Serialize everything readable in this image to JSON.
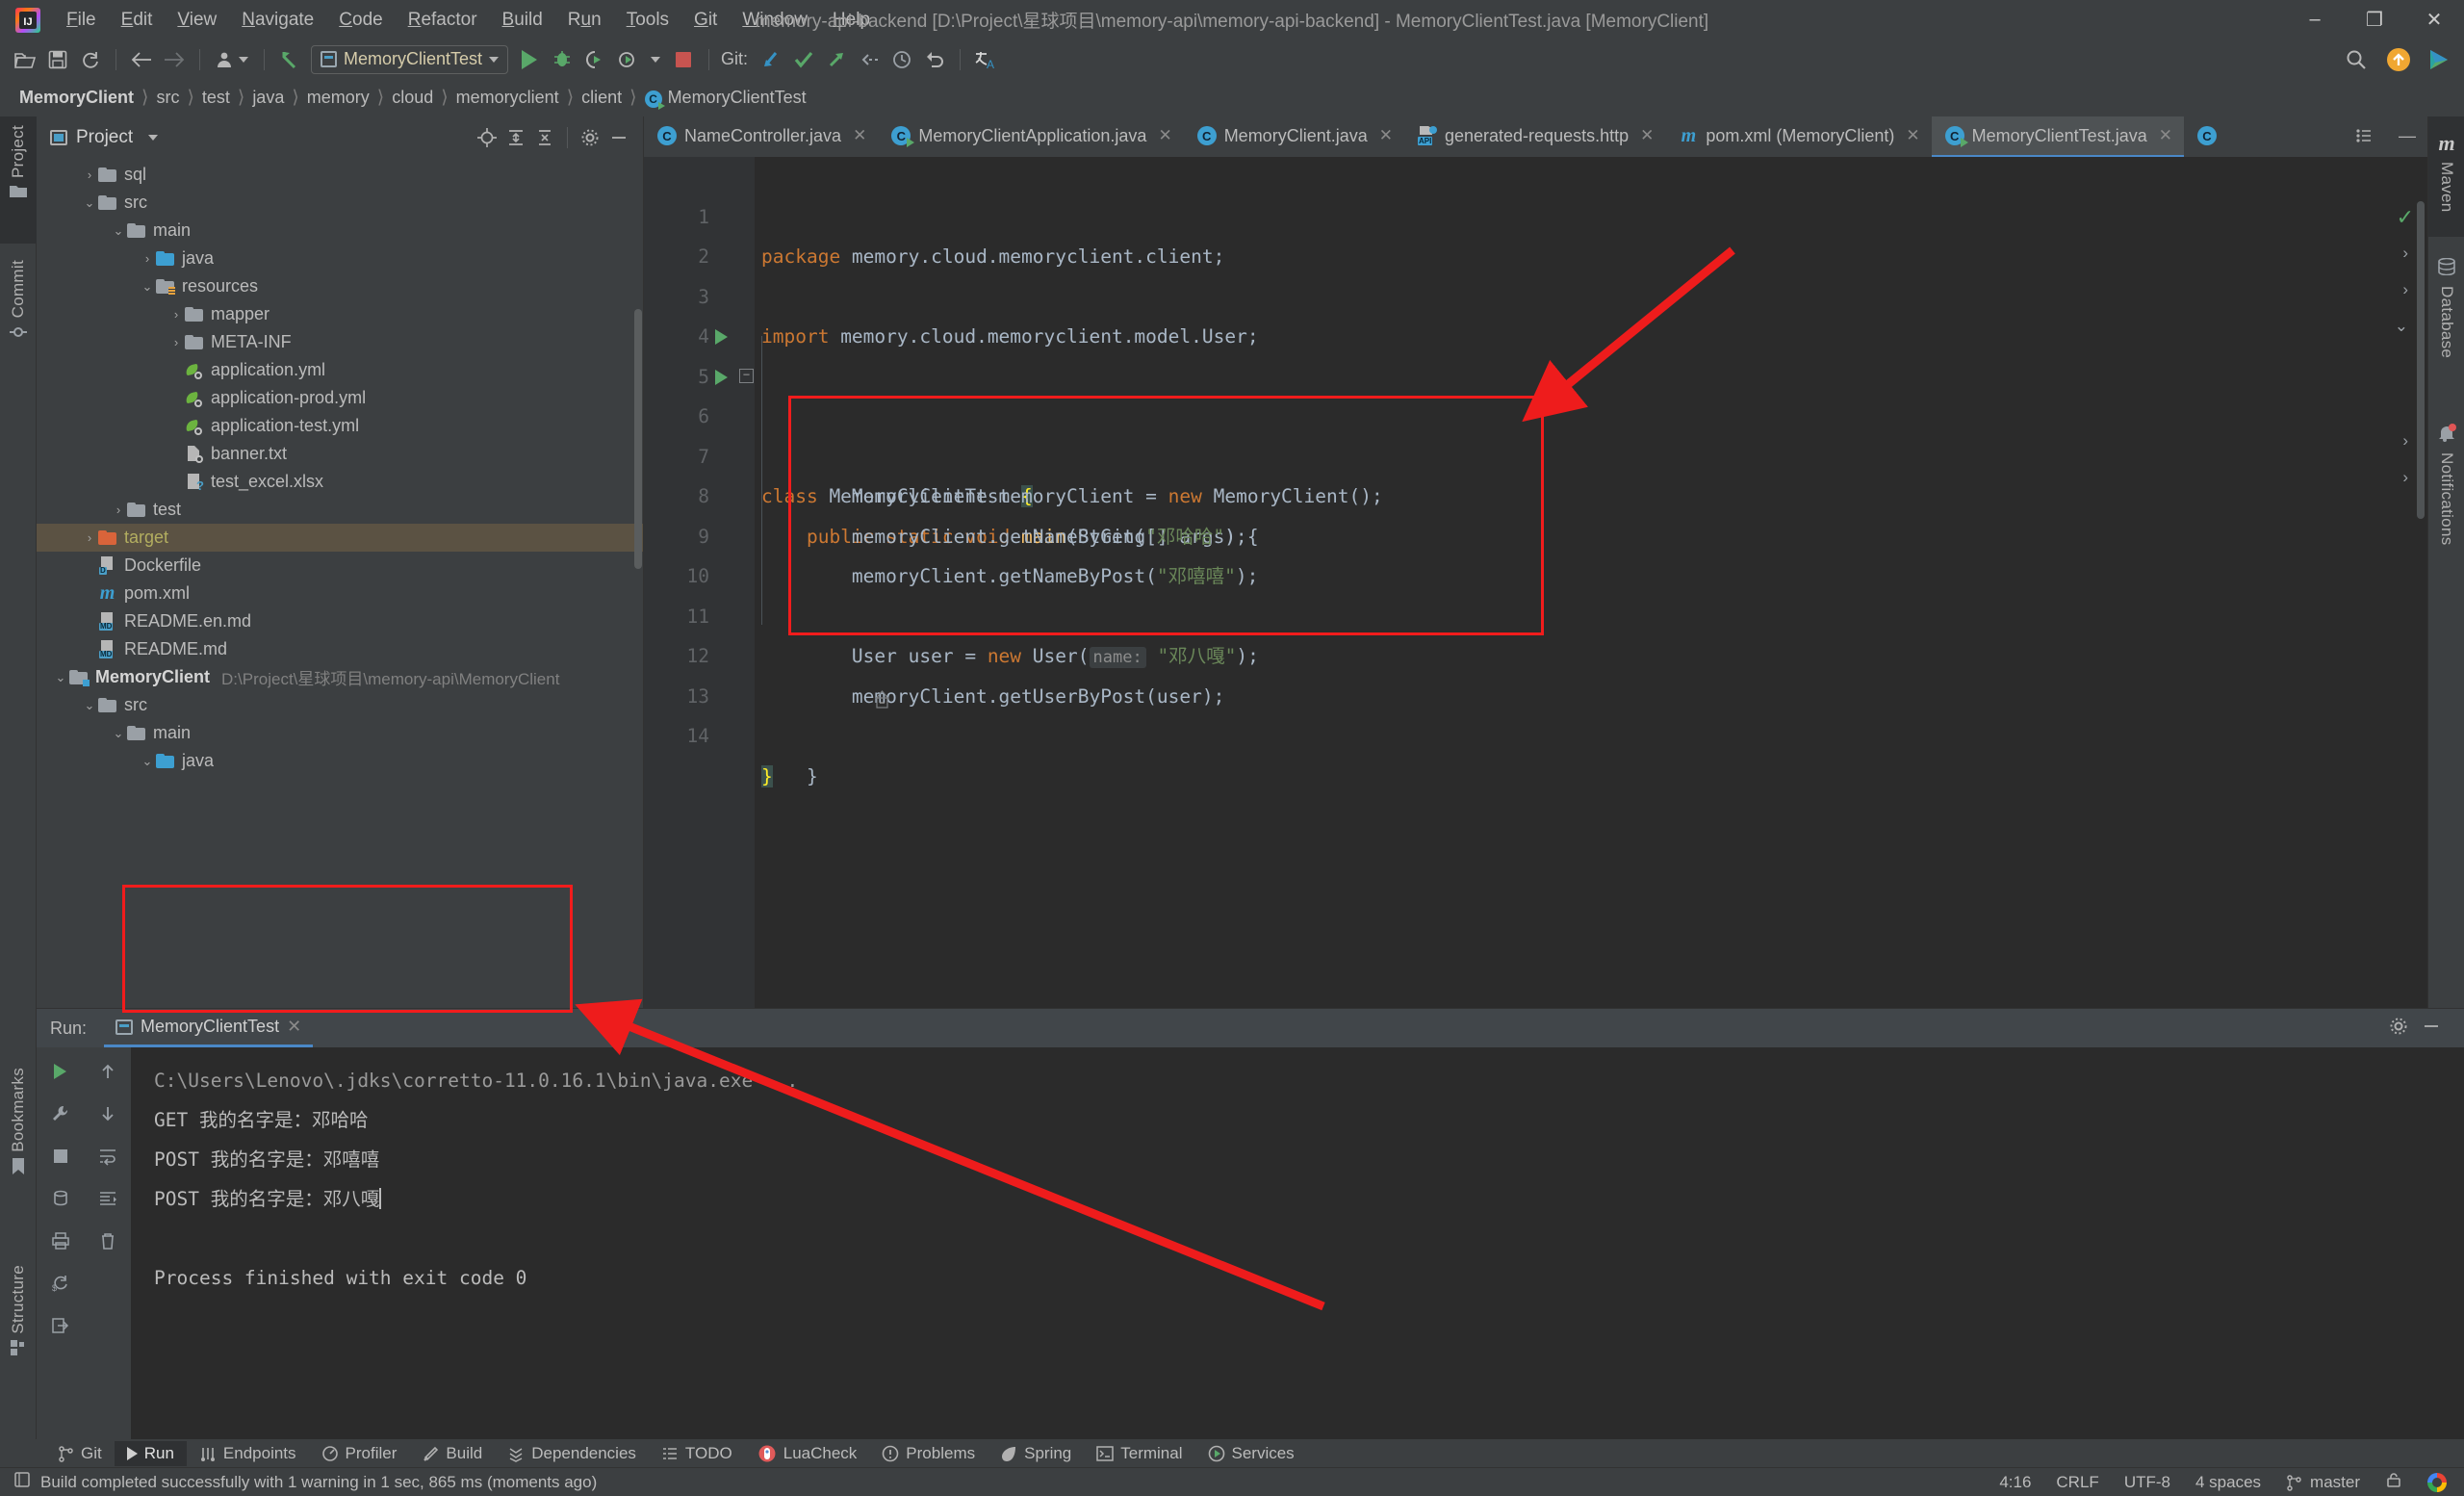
{
  "window": {
    "title": "memory-api-backend [D:\\Project\\星球项目\\memory-api\\memory-api-backend] - MemoryClientTest.java [MemoryClient]",
    "minimize": "—",
    "maximize": "❐",
    "close": "✕",
    "logo_text": "IJ"
  },
  "menubar": {
    "items": [
      {
        "label": "File"
      },
      {
        "label": "Edit"
      },
      {
        "label": "View"
      },
      {
        "label": "Navigate"
      },
      {
        "label": "Code"
      },
      {
        "label": "Refactor"
      },
      {
        "label": "Build"
      },
      {
        "label": "Run"
      },
      {
        "label": "Tools"
      },
      {
        "label": "Git"
      },
      {
        "label": "Window"
      },
      {
        "label": "Help"
      }
    ]
  },
  "toolbar": {
    "run_config": "MemoryClientTest",
    "git_label": "Git:",
    "icons": [
      "open-folder-icon",
      "save-all-icon",
      "sync-icon",
      "back-icon",
      "forward-icon",
      "profile-icon",
      "undo-arrow-icon",
      "run-icon",
      "debug-icon",
      "run-coverage-icon",
      "run-profiler-icon",
      "stop-icon",
      "git-update-icon",
      "git-commit-icon",
      "git-push-icon",
      "git-rollback-icon",
      "git-history-icon",
      "git-revert-icon",
      "translate-icon",
      "search-everywhere-icon",
      "update-available-icon",
      "ide-feature-icon"
    ]
  },
  "breadcrumb": {
    "items": [
      "MemoryClient",
      "src",
      "test",
      "java",
      "memory",
      "cloud",
      "memoryclient",
      "client"
    ],
    "file": "MemoryClientTest",
    "separator": "〉"
  },
  "left_stripe": {
    "items": [
      {
        "label": "Project",
        "icon": "project-folder-icon",
        "selected": true
      },
      {
        "label": "Commit",
        "icon": "commit-icon",
        "selected": false
      },
      {
        "label": "Bookmarks",
        "icon": "bookmark-icon",
        "selected": false
      },
      {
        "label": "Structure",
        "icon": "structure-icon",
        "selected": false
      }
    ]
  },
  "right_stripe": {
    "items": [
      {
        "label": "Maven",
        "icon": "maven-icon",
        "selected": true
      },
      {
        "label": "Database",
        "icon": "database-icon",
        "selected": false
      },
      {
        "label": "Notifications",
        "icon": "bell-icon",
        "selected": false
      }
    ]
  },
  "project_panel": {
    "title": "Project",
    "header_icons": [
      "locate-icon",
      "expand-all-icon",
      "collapse-all-icon",
      "settings-gear-icon",
      "hide-icon"
    ],
    "tree": [
      {
        "indent": 1,
        "arrow": "›",
        "icon": "folder",
        "label": "sql"
      },
      {
        "indent": 1,
        "arrow": "⌄",
        "icon": "folder",
        "label": "src"
      },
      {
        "indent": 2,
        "arrow": "⌄",
        "icon": "folder",
        "label": "main"
      },
      {
        "indent": 3,
        "arrow": "›",
        "icon": "folder-blue",
        "label": "java"
      },
      {
        "indent": 3,
        "arrow": "⌄",
        "icon": "folder-resources",
        "label": "resources"
      },
      {
        "indent": 4,
        "arrow": "›",
        "icon": "folder",
        "label": "mapper"
      },
      {
        "indent": 4,
        "arrow": "›",
        "icon": "folder",
        "label": "META-INF"
      },
      {
        "indent": 4,
        "arrow": "",
        "icon": "yml",
        "label": "application.yml"
      },
      {
        "indent": 4,
        "arrow": "",
        "icon": "yml",
        "label": "application-prod.yml"
      },
      {
        "indent": 4,
        "arrow": "",
        "icon": "yml",
        "label": "application-test.yml"
      },
      {
        "indent": 4,
        "arrow": "",
        "icon": "txt",
        "label": "banner.txt"
      },
      {
        "indent": 4,
        "arrow": "",
        "icon": "xlsx",
        "label": "test_excel.xlsx"
      },
      {
        "indent": 2,
        "arrow": "›",
        "icon": "folder",
        "label": "test"
      },
      {
        "indent": 1,
        "arrow": "›",
        "icon": "folder-orange",
        "label": "target",
        "selected": true
      },
      {
        "indent": 1,
        "arrow": "",
        "icon": "doc-D",
        "label": "Dockerfile"
      },
      {
        "indent": 1,
        "arrow": "",
        "icon": "maven",
        "label": "pom.xml"
      },
      {
        "indent": 1,
        "arrow": "",
        "icon": "doc-MD",
        "label": "README.en.md"
      },
      {
        "indent": 1,
        "arrow": "",
        "icon": "doc-MD",
        "label": "README.md"
      },
      {
        "indent": 0,
        "arrow": "⌄",
        "icon": "folder-module",
        "label": "MemoryClient",
        "bold": true,
        "path": "D:\\Project\\星球项目\\memory-api\\MemoryClient"
      },
      {
        "indent": 1,
        "arrow": "⌄",
        "icon": "folder",
        "label": "src"
      },
      {
        "indent": 2,
        "arrow": "⌄",
        "icon": "folder",
        "label": "main"
      },
      {
        "indent": 3,
        "arrow": "⌄",
        "icon": "folder-blue",
        "label": "java"
      }
    ]
  },
  "editor": {
    "tabs": [
      {
        "label": "NameController.java",
        "icon": "class-icon",
        "active": false
      },
      {
        "label": "MemoryClientApplication.java",
        "icon": "class-run-icon",
        "active": false
      },
      {
        "label": "MemoryClient.java",
        "icon": "class-icon",
        "active": false
      },
      {
        "label": "generated-requests.http",
        "icon": "http-icon",
        "active": false
      },
      {
        "label": "pom.xml (MemoryClient)",
        "icon": "maven-icon",
        "active": false
      },
      {
        "label": "MemoryClientTest.java",
        "icon": "class-run-icon",
        "active": true
      }
    ],
    "tab_close": "✕",
    "inspection_status": "✓",
    "lines": [
      {
        "n": "1",
        "segments": [
          {
            "t": "package",
            "c": "kw"
          },
          {
            "t": " memory.cloud.memoryclient.client;",
            "c": "cls"
          }
        ]
      },
      {
        "n": "2",
        "segments": []
      },
      {
        "n": "3",
        "segments": [
          {
            "t": "import",
            "c": "kw"
          },
          {
            "t": " memory.cloud.memoryclient.model.User;",
            "c": "cls"
          }
        ]
      },
      {
        "n": "4",
        "segments": []
      },
      {
        "n": "5",
        "gutter_run": true,
        "segments": [
          {
            "t": "class",
            "c": "kw"
          },
          {
            "t": " MemoryClientTest ",
            "c": "cls"
          },
          {
            "t": "{",
            "c": "brace-hl"
          }
        ]
      },
      {
        "n": "6",
        "gutter_run": true,
        "fold": "−",
        "segments": [
          {
            "t": "    ",
            "c": "cls"
          },
          {
            "t": "public static void",
            "c": "kw"
          },
          {
            "t": " ",
            "c": "cls"
          },
          {
            "t": "main",
            "c": "mth"
          },
          {
            "t": "(String[] args) {",
            "c": "cls"
          }
        ]
      },
      {
        "n": "7",
        "segments": [
          {
            "t": "        MemoryClient memoryClient = ",
            "c": "cls"
          },
          {
            "t": "new",
            "c": "kw"
          },
          {
            "t": " MemoryClient();",
            "c": "cls"
          }
        ]
      },
      {
        "n": "8",
        "segments": [
          {
            "t": "        memoryClient.getNameByGet(",
            "c": "cls"
          },
          {
            "t": "\"邓哈哈\"",
            "c": "str"
          },
          {
            "t": ");",
            "c": "cls"
          }
        ]
      },
      {
        "n": "9",
        "segments": [
          {
            "t": "        memoryClient.getNameByPost(",
            "c": "cls"
          },
          {
            "t": "\"邓嘻嘻\"",
            "c": "str"
          },
          {
            "t": ");",
            "c": "cls"
          }
        ]
      },
      {
        "n": "10",
        "segments": []
      },
      {
        "n": "11",
        "segments": [
          {
            "t": "        User user = ",
            "c": "cls"
          },
          {
            "t": "new",
            "c": "kw"
          },
          {
            "t": " User(",
            "c": "cls"
          },
          {
            "t": "name:",
            "c": "hint"
          },
          {
            "t": " ",
            "c": "cls"
          },
          {
            "t": "\"邓八嘎\"",
            "c": "str"
          },
          {
            "t": ");",
            "c": "cls"
          }
        ]
      },
      {
        "n": "12",
        "segments": [
          {
            "t": "        memoryClient.getUserByPost(user);",
            "c": "cls"
          }
        ]
      },
      {
        "n": "13",
        "fold": "−",
        "segments": [
          {
            "t": "    }",
            "c": "cls"
          }
        ]
      },
      {
        "n": "14",
        "segments": [
          {
            "t": "}",
            "c": "brace-hl"
          }
        ]
      }
    ]
  },
  "run_panel": {
    "label": "Run:",
    "tab": "MemoryClientTest",
    "tab_close": "✕",
    "header_icons": [
      "settings-gear-icon",
      "hide-icon"
    ],
    "side_icons_col1": [
      "rerun-icon",
      "wrench-icon",
      "stop-icon",
      "dump-icon",
      "print-icon",
      "restart-failed-icon",
      "export-icon"
    ],
    "side_icons_col2": [
      "scroll-up-icon",
      "scroll-down-icon",
      "soft-wrap-icon",
      "scroll-to-end-icon",
      "trash-icon"
    ],
    "console": [
      {
        "text": "C:\\Users\\Lenovo\\.jdks\\corretto-11.0.16.1\\bin\\java.exe ...",
        "dim": true
      },
      {
        "text": "GET 我的名字是：邓哈哈"
      },
      {
        "text": "POST 我的名字是：邓嘻嘻"
      },
      {
        "text": "POST 我的名字是：邓八嘎",
        "caret": true
      },
      {
        "text": ""
      },
      {
        "text": "Process finished with exit code 0"
      }
    ]
  },
  "tool_window_bar": {
    "items": [
      {
        "label": "Git",
        "icon": "git-branch-icon",
        "active": false
      },
      {
        "label": "Run",
        "icon": "run-icon",
        "active": true
      },
      {
        "label": "Endpoints",
        "icon": "endpoints-icon",
        "active": false
      },
      {
        "label": "Profiler",
        "icon": "profiler-icon",
        "active": false
      },
      {
        "label": "Build",
        "icon": "build-hammer-icon",
        "active": false
      },
      {
        "label": "Dependencies",
        "icon": "dependencies-icon",
        "active": false
      },
      {
        "label": "TODO",
        "icon": "todo-list-icon",
        "active": false
      },
      {
        "label": "LuaCheck",
        "icon": "luacheck-icon",
        "active": false
      },
      {
        "label": "Problems",
        "icon": "problems-icon",
        "active": false
      },
      {
        "label": "Spring",
        "icon": "spring-leaf-icon",
        "active": false
      },
      {
        "label": "Terminal",
        "icon": "terminal-icon",
        "active": false
      },
      {
        "label": "Services",
        "icon": "services-icon",
        "active": false
      }
    ]
  },
  "status_bar": {
    "message": "Build completed successfully with 1 warning in 1 sec, 865 ms (moments ago)",
    "message_icon": "build-log-icon",
    "caret_position": "4:16",
    "line_separator": "CRLF",
    "encoding": "UTF-8",
    "indent": "4 spaces",
    "branch": "master",
    "branch_icon": "git-branch-icon",
    "lock_icon": "read-only-lock-icon",
    "account_icon": "google-account-icon"
  },
  "annotations": {
    "highlight_color": "#f11c1c",
    "arrow_color": "#ee1c1c",
    "boxes": [
      {
        "name": "code-highlight-box"
      },
      {
        "name": "console-highlight-box"
      }
    ],
    "arrows": [
      {
        "name": "arrow-to-code"
      },
      {
        "name": "arrow-to-console"
      }
    ]
  }
}
